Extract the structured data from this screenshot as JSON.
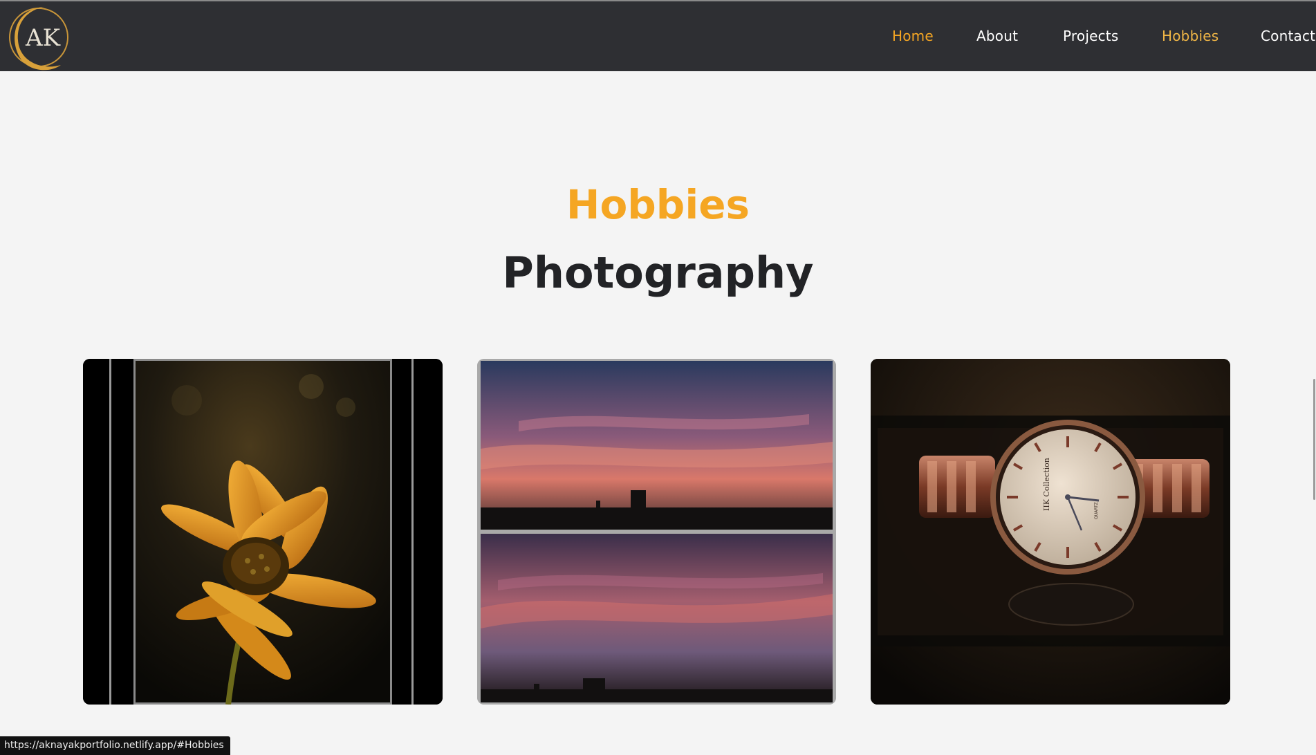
{
  "logo": {
    "monogram": "AK",
    "accent": "#d9a13a"
  },
  "nav": {
    "items": [
      {
        "label": "Home",
        "state": "active"
      },
      {
        "label": "About",
        "state": "normal"
      },
      {
        "label": "Projects",
        "state": "normal"
      },
      {
        "label": "Hobbies",
        "state": "hover"
      },
      {
        "label": "Contact",
        "state": "normal"
      }
    ]
  },
  "section": {
    "title": "Hobbies",
    "subtitle": "Photography"
  },
  "gallery": [
    {
      "subject": "flower"
    },
    {
      "subject": "sunset"
    },
    {
      "subject": "watch",
      "brand_text": "IIK Collection",
      "dial_text": "QUARTZ"
    }
  ],
  "status_bar": {
    "url": "https://aknayakportfolio.netlify.app/#Hobbies"
  },
  "colors": {
    "accent": "#f5a623",
    "header_bg": "#2e2f33",
    "page_bg": "#f4f4f4",
    "heading": "#222326"
  }
}
